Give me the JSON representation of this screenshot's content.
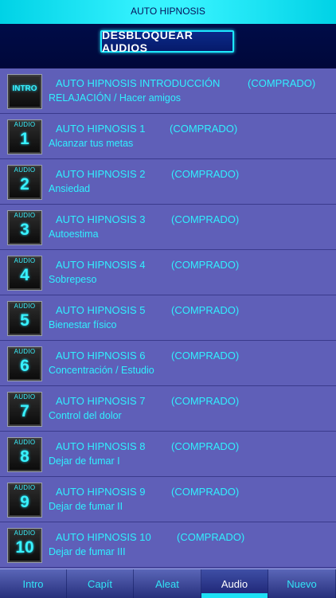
{
  "header": {
    "title": "AUTO HIPNOSIS",
    "unlock_label": "DESBLOQUEAR AUDIOS"
  },
  "items": [
    {
      "badge_top": "",
      "badge_main": "INTRO",
      "title": "AUTO HIPNOSIS INTRODUCCIÓN",
      "status": "(COMPRADO)",
      "subtitle": "RELAJACIÓN / Hacer amigos"
    },
    {
      "badge_top": "AUDIO",
      "badge_main": "1",
      "title": "AUTO HIPNOSIS 1",
      "status": "(COMPRADO)",
      "subtitle": "Alcanzar tus metas"
    },
    {
      "badge_top": "AUDIO",
      "badge_main": "2",
      "title": "AUTO HIPNOSIS 2",
      "status": "(COMPRADO)",
      "subtitle": "Ansiedad"
    },
    {
      "badge_top": "AUDIO",
      "badge_main": "3",
      "title": "AUTO HIPNOSIS 3",
      "status": "(COMPRADO)",
      "subtitle": "Autoestima"
    },
    {
      "badge_top": "AUDIO",
      "badge_main": "4",
      "title": "AUTO HIPNOSIS 4",
      "status": "(COMPRADO)",
      "subtitle": "Sobrepeso"
    },
    {
      "badge_top": "AUDIO",
      "badge_main": "5",
      "title": "AUTO HIPNOSIS 5",
      "status": "(COMPRADO)",
      "subtitle": "Bienestar físico"
    },
    {
      "badge_top": "AUDIO",
      "badge_main": "6",
      "title": "AUTO HIPNOSIS 6",
      "status": "(COMPRADO)",
      "subtitle": "Concentración / Estudio"
    },
    {
      "badge_top": "AUDIO",
      "badge_main": "7",
      "title": "AUTO HIPNOSIS 7",
      "status": "(COMPRADO)",
      "subtitle": "Control del dolor"
    },
    {
      "badge_top": "AUDIO",
      "badge_main": "8",
      "title": "AUTO HIPNOSIS 8",
      "status": "(COMPRADO)",
      "subtitle": "Dejar de fumar I"
    },
    {
      "badge_top": "AUDIO",
      "badge_main": "9",
      "title": "AUTO HIPNOSIS 9",
      "status": "(COMPRADO)",
      "subtitle": "Dejar de fumar II"
    },
    {
      "badge_top": "AUDIO",
      "badge_main": "10",
      "title": "AUTO HIPNOSIS 10",
      "status": "(COMPRADO)",
      "subtitle": "Dejar de fumar III"
    }
  ],
  "tabs": [
    {
      "label": "Intro",
      "active": false
    },
    {
      "label": "Capít",
      "active": false
    },
    {
      "label": "Aleat",
      "active": false
    },
    {
      "label": "Audio",
      "active": true
    },
    {
      "label": "Nuevo",
      "active": false
    }
  ],
  "colors": {
    "accent": "#30f0ff",
    "list_bg": "#5f5fb8",
    "header_bg": "#000c48"
  }
}
